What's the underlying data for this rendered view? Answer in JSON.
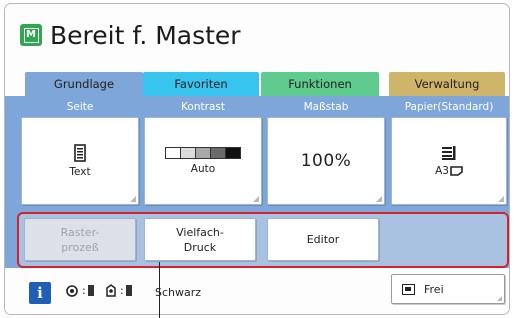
{
  "header": {
    "icon_glyph": "M",
    "title": "Bereit f. Master"
  },
  "tabs": [
    {
      "label": "Grundlage",
      "color": "#7ea6d8",
      "selected": true
    },
    {
      "label": "Favoriten",
      "color": "#37c4ee"
    },
    {
      "label": "Funktionen",
      "color": "#5fcb8f"
    },
    {
      "label": "Verwaltung",
      "color": "#cfb56a"
    }
  ],
  "settings": [
    {
      "label": "Seite",
      "icon": "document-icon",
      "value": "Text"
    },
    {
      "label": "Kontrast",
      "icon": "contrast-scale-icon",
      "value": "Auto"
    },
    {
      "label": "Maßstab",
      "value": "100%"
    },
    {
      "label": "Papier(Standard)",
      "icon": "paper-stack-icon",
      "value": "A3"
    }
  ],
  "secondary_buttons": [
    {
      "label": "Raster-\nprozeß",
      "enabled": false
    },
    {
      "label": "Vielfach-\nDruck",
      "enabled": true
    },
    {
      "label": "Editor",
      "enabled": true
    }
  ],
  "status_bar": {
    "info_label": "i",
    "status_text": "Schwarz",
    "frei_label": "Frei"
  },
  "colors": {
    "panel": "#7ea6d8",
    "highlight_border": "#d4232c",
    "master_icon": "#2fa84f",
    "info_button": "#1f5fb5"
  }
}
